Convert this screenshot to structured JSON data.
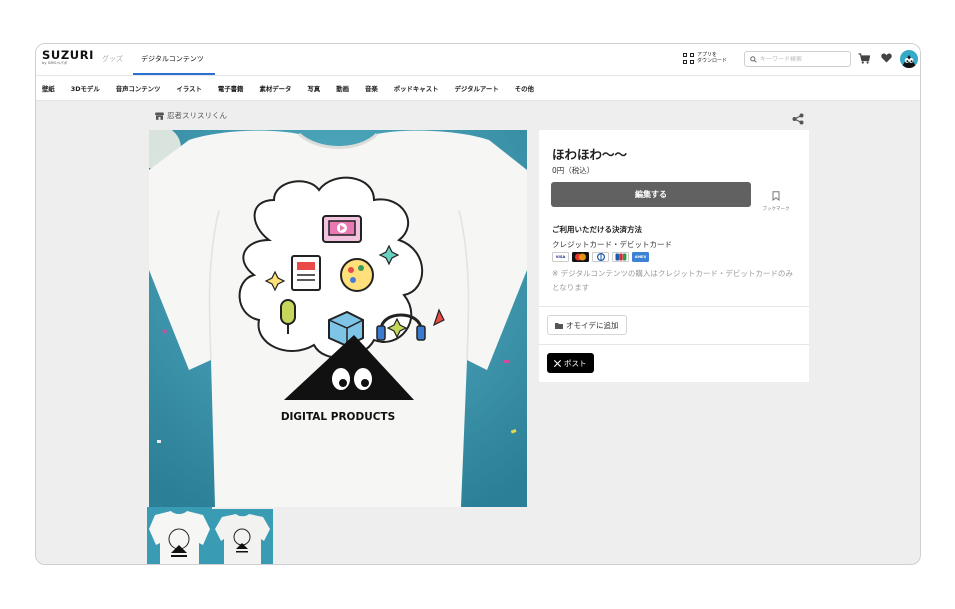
{
  "header": {
    "logo_text": "SUZURI",
    "logo_sub": "by GMOペパボ",
    "tabs": [
      {
        "label": "グッズ",
        "active": false
      },
      {
        "label": "デジタルコンテンツ",
        "active": true
      }
    ],
    "app_download": {
      "line1": "アプリを",
      "line2": "ダウンロード"
    },
    "search": {
      "placeholder": "キーワード検索"
    },
    "icons": [
      "qr-code-icon",
      "search-icon",
      "cart-icon",
      "heart-icon",
      "user-avatar"
    ],
    "accent_color": "#2d6fd3"
  },
  "categories": [
    "壁紙",
    "3Dモデル",
    "音声コンテンツ",
    "イラスト",
    "電子書籍",
    "素材データ",
    "写真",
    "動画",
    "音楽",
    "ポッドキャスト",
    "デジタルアート",
    "その他"
  ],
  "creator": {
    "name": "忍者スリスリくん",
    "icon": "shop-icon"
  },
  "product": {
    "title": "ほわほわ〜〜",
    "price": "0円（税込）",
    "edit_button": "編集する",
    "bookmark_label": "ブックマーク",
    "artwork_text": "DIGITAL PRODUCTS",
    "thumbnail_count": 2
  },
  "payment": {
    "title": "ご利用いただける決済方法",
    "methods": "クレジットカード・デビットカード",
    "cards": [
      "VISA",
      "Mastercard",
      "Diners",
      "JCB",
      "AMEX"
    ],
    "note": "※ デジタルコンテンツの購入はクレジットカード・デビットカードのみとなります"
  },
  "actions": {
    "omoide_label": "オモイデに追加",
    "xpost_label": "ポスト"
  }
}
